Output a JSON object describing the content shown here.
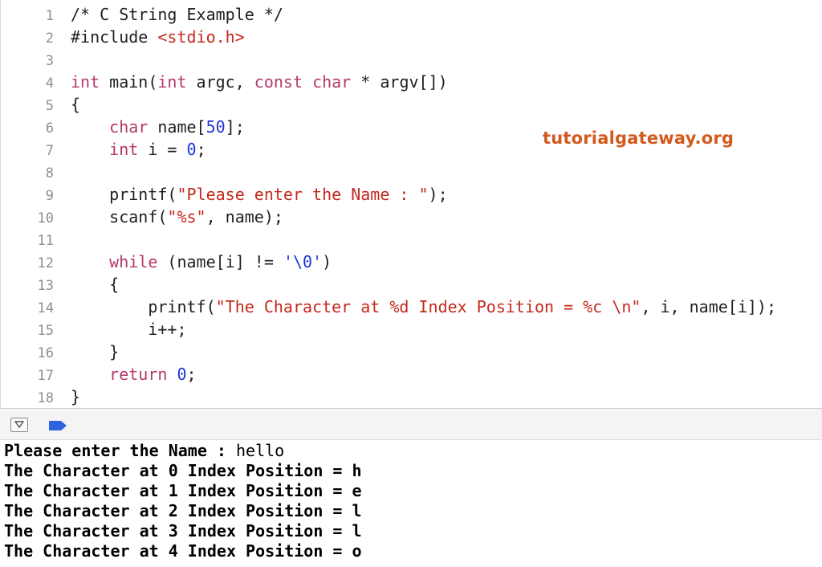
{
  "editor": {
    "lines": [
      {
        "num": "1",
        "tokens": [
          {
            "t": "/* C String Example */",
            "c": "plain"
          }
        ]
      },
      {
        "num": "2",
        "tokens": [
          {
            "t": "#include ",
            "c": "plain"
          },
          {
            "t": "<stdio.h>",
            "c": "str"
          }
        ]
      },
      {
        "num": "3",
        "tokens": []
      },
      {
        "num": "4",
        "tokens": [
          {
            "t": "int",
            "c": "kw"
          },
          {
            "t": " main(",
            "c": "plain"
          },
          {
            "t": "int",
            "c": "kw"
          },
          {
            "t": " argc, ",
            "c": "plain"
          },
          {
            "t": "const",
            "c": "kw"
          },
          {
            "t": " ",
            "c": "plain"
          },
          {
            "t": "char",
            "c": "kw"
          },
          {
            "t": " * argv[])",
            "c": "plain"
          }
        ]
      },
      {
        "num": "5",
        "tokens": [
          {
            "t": "{",
            "c": "plain"
          }
        ]
      },
      {
        "num": "6",
        "tokens": [
          {
            "t": "    ",
            "c": "plain"
          },
          {
            "t": "char",
            "c": "kw"
          },
          {
            "t": " name[",
            "c": "plain"
          },
          {
            "t": "50",
            "c": "num"
          },
          {
            "t": "];",
            "c": "plain"
          }
        ]
      },
      {
        "num": "7",
        "tokens": [
          {
            "t": "    ",
            "c": "plain"
          },
          {
            "t": "int",
            "c": "kw"
          },
          {
            "t": " i = ",
            "c": "plain"
          },
          {
            "t": "0",
            "c": "num"
          },
          {
            "t": ";",
            "c": "plain"
          }
        ]
      },
      {
        "num": "8",
        "tokens": []
      },
      {
        "num": "9",
        "tokens": [
          {
            "t": "    printf(",
            "c": "plain"
          },
          {
            "t": "\"Please enter the Name : \"",
            "c": "str"
          },
          {
            "t": ");",
            "c": "plain"
          }
        ]
      },
      {
        "num": "10",
        "tokens": [
          {
            "t": "    scanf(",
            "c": "plain"
          },
          {
            "t": "\"%s\"",
            "c": "str"
          },
          {
            "t": ", name);",
            "c": "plain"
          }
        ]
      },
      {
        "num": "11",
        "tokens": []
      },
      {
        "num": "12",
        "tokens": [
          {
            "t": "    ",
            "c": "plain"
          },
          {
            "t": "while",
            "c": "kw"
          },
          {
            "t": " (name[i] != ",
            "c": "plain"
          },
          {
            "t": "'\\0'",
            "c": "num"
          },
          {
            "t": ")",
            "c": "plain"
          }
        ]
      },
      {
        "num": "13",
        "tokens": [
          {
            "t": "    {",
            "c": "plain"
          }
        ]
      },
      {
        "num": "14",
        "tokens": [
          {
            "t": "        printf(",
            "c": "plain"
          },
          {
            "t": "\"The Character at %d Index Position = %c \\n\"",
            "c": "str"
          },
          {
            "t": ", i, name[i]);",
            "c": "plain"
          }
        ]
      },
      {
        "num": "15",
        "tokens": [
          {
            "t": "        i++;",
            "c": "plain"
          }
        ]
      },
      {
        "num": "16",
        "tokens": [
          {
            "t": "    }",
            "c": "plain"
          }
        ]
      },
      {
        "num": "17",
        "tokens": [
          {
            "t": "    ",
            "c": "plain"
          },
          {
            "t": "return",
            "c": "kw"
          },
          {
            "t": " ",
            "c": "plain"
          },
          {
            "t": "0",
            "c": "num"
          },
          {
            "t": ";",
            "c": "plain"
          }
        ]
      },
      {
        "num": "18",
        "tokens": [
          {
            "t": "}",
            "c": "plain"
          }
        ]
      }
    ]
  },
  "watermark": {
    "text": "tutorialgateway.org",
    "color": "#d25a1f"
  },
  "debug_bar": {
    "toggle_icon": "triangle-down-icon",
    "breakpoint_icon": "breakpoint-arrow-icon",
    "breakpoint_color": "#2f62e0"
  },
  "console": {
    "prompt": "Please enter the Name : ",
    "user_input": "hello",
    "output_lines": [
      "The Character at 0 Index Position = h",
      "The Character at 1 Index Position = e",
      "The Character at 2 Index Position = l",
      "The Character at 3 Index Position = l",
      "The Character at 4 Index Position = o"
    ]
  }
}
